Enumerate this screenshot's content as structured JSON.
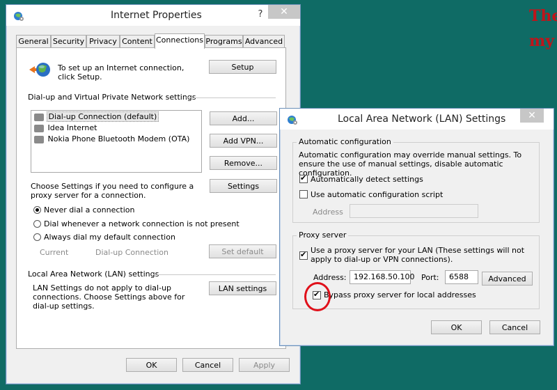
{
  "corner_text": {
    "line1": "The",
    "line2": "my"
  },
  "ip": {
    "title": "Internet Properties",
    "help": "?",
    "close": "✕",
    "tabs": [
      "General",
      "Security",
      "Privacy",
      "Content",
      "Connections",
      "Programs",
      "Advanced"
    ],
    "setup_text": "To set up an Internet connection, click Setup.",
    "setup_btn": "Setup",
    "dialup_heading": "Dial-up and Virtual Private Network settings",
    "connections": [
      "Dial-up Connection (default)",
      "Idea Internet",
      "Nokia Phone Bluetooth Modem (OTA)"
    ],
    "add_btn": "Add...",
    "add_vpn_btn": "Add VPN...",
    "remove_btn": "Remove...",
    "settings_text": "Choose Settings if you need to configure a proxy server for a connection.",
    "settings_btn": "Settings",
    "radio_never": "Never dial a connection",
    "radio_whenever": "Dial whenever a network connection is not present",
    "radio_always": "Always dial my default connection",
    "current_label": "Current",
    "current_value": "Dial-up Connection",
    "set_default_btn": "Set default",
    "lan_heading": "Local Area Network (LAN) settings",
    "lan_text": "LAN Settings do not apply to dial-up connections. Choose Settings above for dial-up settings.",
    "lan_btn": "LAN settings",
    "ok_btn": "OK",
    "cancel_btn": "Cancel",
    "apply_btn": "Apply"
  },
  "lan": {
    "title": "Local Area Network (LAN) Settings",
    "close": "✕",
    "auto_group": "Automatic configuration",
    "auto_text": "Automatic configuration may override manual settings.  To ensure the use of manual settings, disable automatic configuration.",
    "auto_detect": "Automatically detect settings",
    "auto_script": "Use automatic configuration script",
    "address_label": "Address",
    "script_address": "",
    "proxy_group": "Proxy server",
    "proxy_use": "Use a proxy server for your LAN (These settings will not apply to dial-up or VPN connections).",
    "proxy_address_label": "Address:",
    "proxy_address": "192.168.50.100",
    "port_label": "Port:",
    "port": "6588",
    "advanced_btn": "Advanced",
    "bypass": "Bypass proxy server for local addresses",
    "ok_btn": "OK",
    "cancel_btn": "Cancel"
  },
  "state": {
    "auto_detect_checked": true,
    "auto_script_checked": false,
    "proxy_checked": true,
    "bypass_checked": true,
    "selected_radio": "never"
  },
  "colors": {
    "desktop": "#0f6b65",
    "annotation": "#e0101a",
    "corner_text": "#c0141a"
  }
}
